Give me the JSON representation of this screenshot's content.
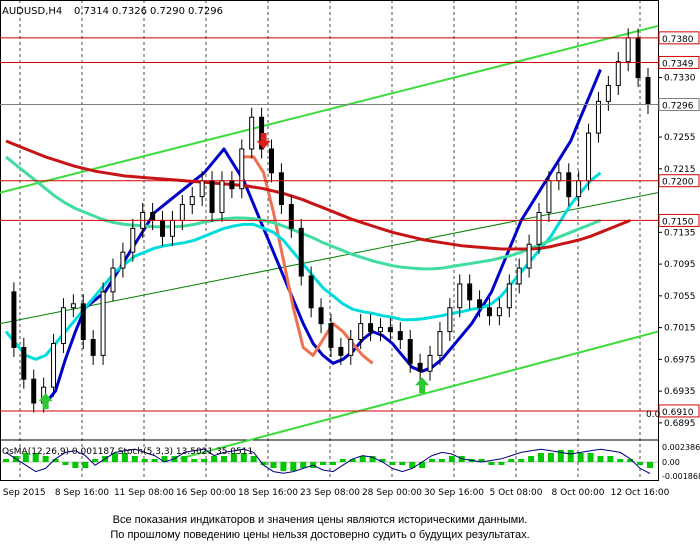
{
  "chart_data": {
    "type": "line",
    "title": "AUDUSD,H4",
    "ohlc": {
      "open": "0.7314",
      "high": "0.7326",
      "low": "0.7290",
      "close": "0.7296"
    },
    "y_axis": {
      "ylim": [
        0.6886,
        0.7405
      ],
      "ticks": [
        "0.7330",
        "0.7255",
        "0.7215",
        "0.7135",
        "0.7095",
        "0.7055",
        "0.7015",
        "0.6975",
        "0.6935",
        "0.6895"
      ]
    },
    "x_axis": {
      "ticks": [
        "3 Sep 2015",
        "8 Sep 16:00",
        "11 Sep 08:00",
        "16 Sep 00:00",
        "18 Sep 16:00",
        "23 Sep 08:00",
        "28 Sep 00:00",
        "30 Sep 16:00",
        "5 Oct 08:00",
        "8 Oct 00:00",
        "12 Oct 16:00"
      ]
    },
    "levels": [
      {
        "value": 0.738,
        "label": "0.7380",
        "color": "#d40000"
      },
      {
        "value": 0.7349,
        "label": "0.7349",
        "color": "#d40000"
      },
      {
        "value": 0.7296,
        "label": "0.7296",
        "color": "#808080"
      },
      {
        "value": 0.72,
        "label": "0.7200",
        "color": "#d40000"
      },
      {
        "value": 0.715,
        "label": "0.7150",
        "color": "#d40000"
      },
      {
        "value": 0.691,
        "label": "0.6910",
        "color": "#d40000"
      }
    ],
    "price_series": [
      0.706,
      0.699,
      0.695,
      0.692,
      0.694,
      0.6995,
      0.704,
      0.7045,
      0.7,
      0.698,
      0.706,
      0.709,
      0.711,
      0.714,
      0.716,
      0.715,
      0.713,
      0.715,
      0.717,
      0.718,
      0.72,
      0.716,
      0.72,
      0.719,
      0.724,
      0.728,
      0.724,
      0.721,
      0.717,
      0.714,
      0.708,
      0.704,
      0.702,
      0.699,
      0.698,
      0.7,
      0.702,
      0.701,
      0.7015,
      0.701,
      0.7,
      0.697,
      0.696,
      0.698,
      0.701,
      0.704,
      0.707,
      0.705,
      0.704,
      0.703,
      0.704,
      0.707,
      0.709,
      0.712,
      0.716,
      0.72,
      0.721,
      0.718,
      0.72,
      0.726,
      0.73,
      0.732,
      0.735,
      0.738,
      0.733,
      0.7296
    ],
    "moving_averages": [
      {
        "color": "#0000c8",
        "values": [
          null,
          null,
          null,
          null,
          0.692,
          0.6935,
          0.6975,
          0.701,
          0.704,
          0.705,
          0.706,
          0.708,
          0.71,
          0.712,
          0.714,
          0.716,
          0.717,
          0.718,
          0.719,
          0.72,
          0.721,
          0.7225,
          0.724,
          0.722,
          0.72,
          0.717,
          0.714,
          0.711,
          0.708,
          0.705,
          0.702,
          0.6995,
          0.698,
          0.697,
          0.6975,
          0.6985,
          0.7,
          0.701,
          0.7005,
          0.6995,
          0.698,
          0.6965,
          0.696,
          0.6965,
          0.6975,
          0.699,
          0.7005,
          0.702,
          0.704,
          0.706,
          0.709,
          0.712,
          0.715,
          0.717,
          0.719,
          0.721,
          0.723,
          0.725,
          0.728,
          0.731,
          0.734,
          null,
          null,
          null,
          null,
          null
        ]
      },
      {
        "color": "#f07050",
        "values": [
          null,
          null,
          null,
          null,
          null,
          null,
          null,
          null,
          null,
          null,
          null,
          null,
          null,
          null,
          null,
          null,
          null,
          null,
          null,
          null,
          null,
          null,
          null,
          null,
          0.723,
          0.723,
          0.721,
          0.716,
          0.71,
          0.704,
          0.699,
          0.698,
          0.7,
          0.702,
          0.701,
          0.6995,
          0.698,
          0.697,
          null,
          null,
          null,
          null,
          null,
          null,
          null,
          null,
          null,
          null,
          null,
          null,
          null,
          null,
          null,
          null,
          null,
          null,
          null,
          null,
          null,
          null,
          null,
          null,
          null,
          null,
          null,
          null
        ]
      },
      {
        "color": "#00dcdc",
        "values": [
          0.701,
          0.6995,
          0.698,
          0.6975,
          0.698,
          0.6995,
          0.701,
          0.7025,
          0.704,
          0.7055,
          0.707,
          0.7085,
          0.7095,
          0.7105,
          0.711,
          0.7115,
          0.7118,
          0.712,
          0.7122,
          0.7125,
          0.713,
          0.7135,
          0.714,
          0.7143,
          0.7145,
          0.7145,
          0.714,
          0.7135,
          0.7125,
          0.711,
          0.7095,
          0.708,
          0.7065,
          0.7055,
          0.7045,
          0.7038,
          0.7035,
          0.7033,
          0.703,
          0.7028,
          0.7025,
          0.7025,
          0.7026,
          0.7028,
          0.703,
          0.7033,
          0.7035,
          0.7038,
          0.704,
          0.7045,
          0.7055,
          0.707,
          0.7085,
          0.71,
          0.7115,
          0.713,
          0.715,
          0.717,
          0.7185,
          0.72,
          0.721,
          null,
          null,
          null,
          null,
          null
        ]
      },
      {
        "color": "#40dca0",
        "values": [
          0.723,
          0.722,
          0.721,
          0.72,
          0.719,
          0.718,
          0.7172,
          0.7165,
          0.716,
          0.7155,
          0.715,
          0.7147,
          0.7145,
          0.7144,
          0.7143,
          0.7142,
          0.7142,
          0.7142,
          0.7143,
          0.7145,
          0.7148,
          0.715,
          0.7152,
          0.7153,
          0.7153,
          0.7152,
          0.715,
          0.7147,
          0.7143,
          0.7138,
          0.7133,
          0.7128,
          0.7122,
          0.7117,
          0.7112,
          0.7107,
          0.7103,
          0.7099,
          0.7096,
          0.7093,
          0.7091,
          0.709,
          0.7089,
          0.7089,
          0.709,
          0.7092,
          0.7094,
          0.7096,
          0.7098,
          0.71,
          0.7103,
          0.7106,
          0.711,
          0.7115,
          0.712,
          0.7125,
          0.713,
          0.7135,
          0.714,
          0.7145,
          0.715,
          null,
          null,
          null,
          null,
          null
        ]
      },
      {
        "color": "#c81414",
        "values": [
          0.725,
          0.7245,
          0.724,
          0.7235,
          0.723,
          0.7226,
          0.7222,
          0.7218,
          0.7215,
          0.7212,
          0.721,
          0.7208,
          0.7206,
          0.7205,
          0.7204,
          0.7203,
          0.7202,
          0.7201,
          0.72,
          0.7199,
          0.7198,
          0.7197,
          0.7196,
          0.7195,
          0.7194,
          0.7192,
          0.719,
          0.7187,
          0.7184,
          0.718,
          0.7176,
          0.7171,
          0.7166,
          0.7161,
          0.7156,
          0.7151,
          0.7147,
          0.7143,
          0.7139,
          0.7135,
          0.7132,
          0.7129,
          0.7126,
          0.7124,
          0.7122,
          0.712,
          0.7118,
          0.7117,
          0.7116,
          0.7115,
          0.7114,
          0.7114,
          0.7114,
          0.7114,
          0.7115,
          0.7117,
          0.712,
          0.7123,
          0.7126,
          0.713,
          0.7135,
          0.714,
          0.7145,
          0.715,
          null,
          null
        ]
      }
    ],
    "channel": {
      "upper": [
        0.7185,
        0.7395
      ],
      "lower": [
        0.685,
        0.701
      ],
      "color": "#3cdc3c"
    },
    "oscillator": {
      "label": "OsMA(12,26,9) 0.001187   Stoch(5,3,3) 13.5021 35.0511",
      "levels": [
        "0.002386",
        "0.00",
        "-0.001868"
      ],
      "zero_label": "0.0",
      "histogram": [
        1,
        2,
        3,
        3,
        2,
        1,
        -1,
        -2,
        -2,
        1,
        2,
        3,
        3,
        2,
        1,
        1,
        2,
        2,
        2,
        1,
        1,
        2,
        2,
        3,
        3,
        2,
        -1,
        -2,
        -3,
        -3,
        -2,
        -2,
        -1,
        -1,
        1,
        1,
        2,
        2,
        1,
        -1,
        -1,
        -2,
        -2,
        1,
        1,
        2,
        2,
        1,
        1,
        -1,
        -1,
        1,
        1,
        2,
        3,
        3,
        4,
        4,
        3,
        3,
        2,
        2,
        1,
        1,
        -1,
        -2
      ],
      "stoch_k": [
        80,
        60,
        40,
        20,
        30,
        60,
        80,
        85,
        70,
        40,
        60,
        80,
        85,
        90,
        80,
        70,
        50,
        60,
        80,
        85,
        90,
        70,
        80,
        85,
        90,
        80,
        40,
        20,
        15,
        20,
        30,
        40,
        25,
        20,
        40,
        60,
        70,
        65,
        50,
        30,
        20,
        30,
        50,
        70,
        80,
        75,
        60,
        55,
        50,
        55,
        60,
        70,
        80,
        85,
        90,
        85,
        80,
        75,
        80,
        85,
        90,
        85,
        80,
        60,
        30,
        14
      ]
    },
    "signals": [
      {
        "kind": "buy",
        "color": "#2dc82d",
        "index": 4
      },
      {
        "kind": "sell",
        "color": "#dc1e1e",
        "index": 26
      },
      {
        "kind": "buy",
        "color": "#2dc82d",
        "index": 42
      }
    ]
  },
  "disclaimer": {
    "line1": "Все показания индикаторов и значения цены являются историческими данными.",
    "line2": "По прошлому поведению цены нельзя достоверно судить о будущих результатах."
  }
}
